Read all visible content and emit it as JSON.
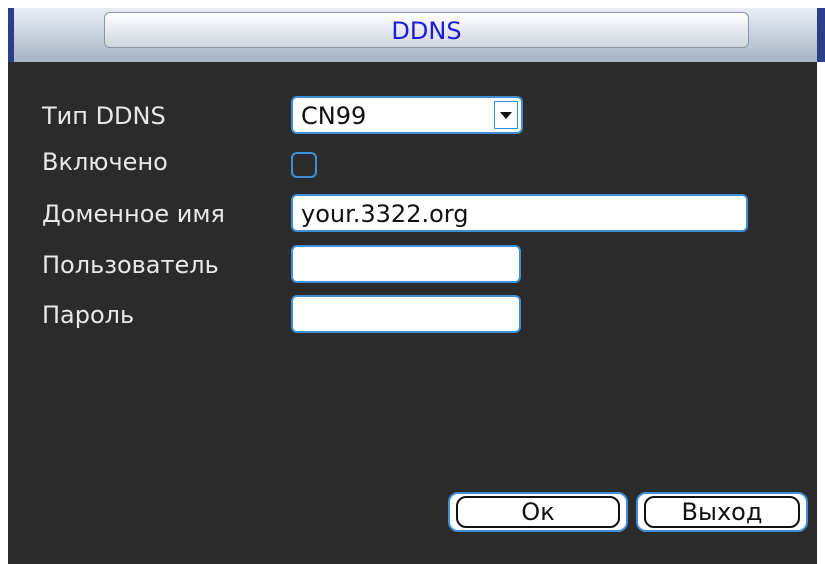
{
  "window": {
    "title": "DDNS"
  },
  "form": {
    "ddns_type": {
      "label": "Тип DDNS",
      "value": "CN99"
    },
    "enabled": {
      "label": "Включено",
      "checked": false
    },
    "domain": {
      "label": "Доменное имя",
      "value": "your.3322.org"
    },
    "user": {
      "label": "Пользователь",
      "value": ""
    },
    "password": {
      "label": "Пароль",
      "value": ""
    }
  },
  "buttons": {
    "ok": "Ок",
    "exit": "Выход"
  },
  "colors": {
    "accent": "#3f8fd8",
    "panel_bg": "#2b2b2b",
    "title_text": "#1a1ad8"
  }
}
